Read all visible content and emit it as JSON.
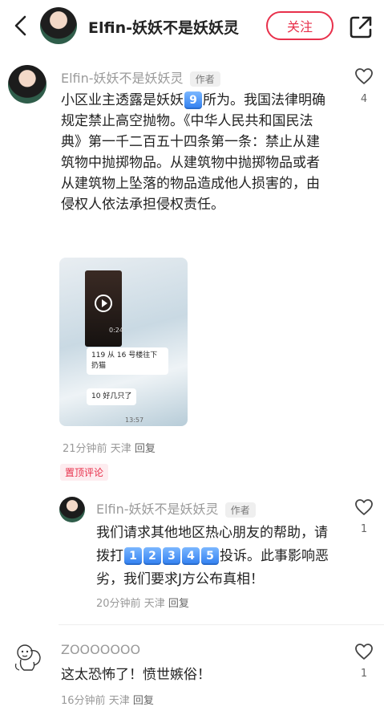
{
  "header": {
    "title": "Elfin-妖妖不是妖妖灵",
    "follow_label": "关注"
  },
  "comments": [
    {
      "author": "Elfin-妖妖不是妖妖灵",
      "tag": "作者",
      "text_before": "小区业主透露是妖妖",
      "badge": "9",
      "text_after": "所为。我国法律明确规定禁止高空抛物。《中华人民共和国民法典》第一千二百五十四条第一条：禁止从建筑物中抛掷物品。从建筑物中抛掷物品或者从建筑物上坠落的物品造成他人损害的，由侵权人依法承担侵权责任。",
      "likes": "4",
      "time": "21分钟前",
      "location": "天津",
      "reply_label": "回复",
      "pinned_label": "置顶评论",
      "media": {
        "msg1": "119 从 16 号楼往下扔猫",
        "msg2": "10 好几只了",
        "time_a": "0:24",
        "time_b": "13:57"
      }
    },
    {
      "author": "Elfin-妖妖不是妖妖灵",
      "tag": "作者",
      "text_before": "我们请求其他地区热心朋友的帮助，请拨打",
      "digits": [
        "1",
        "2",
        "3",
        "4",
        "5"
      ],
      "text_after": "投诉。此事影响恶劣，我们要求J方公布真相！",
      "time": "20分钟前",
      "location": "天津",
      "reply_label": "回复",
      "likes": "1"
    },
    {
      "author": "ZOOOOOOO",
      "text": "这太恐怖了！愤世嫉俗！",
      "time": "16分钟前",
      "location": "天津",
      "reply_label": "回复",
      "likes": "1"
    }
  ],
  "colors": {
    "accent": "#e8304b",
    "badge": "#2f7ef0"
  }
}
